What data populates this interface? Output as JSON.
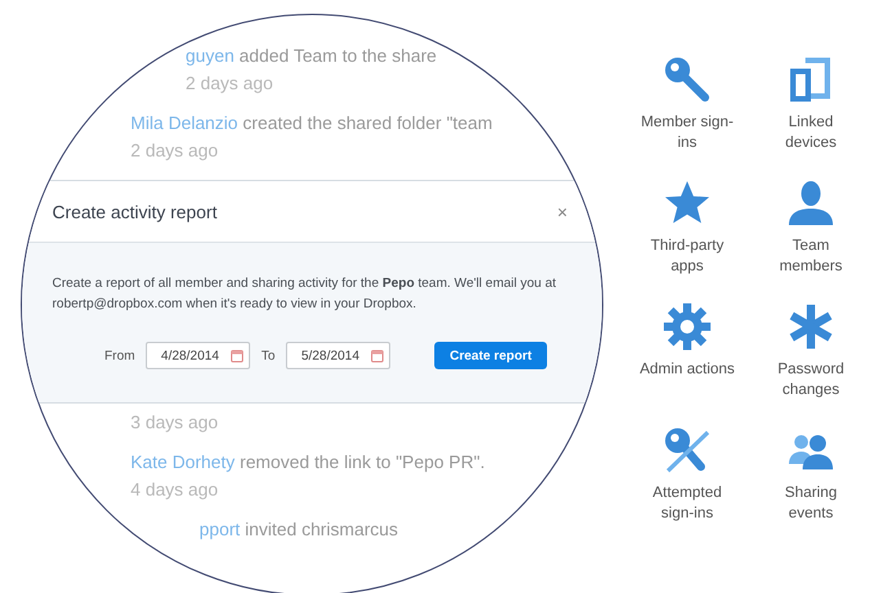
{
  "feed_top": [
    {
      "actor": "guyen",
      "action": "added Team to the share",
      "time": "2 days ago"
    },
    {
      "actor": "Mila Delanzio",
      "action": "created the shared folder \"team",
      "time": "2 days ago"
    }
  ],
  "modal": {
    "title": "Create activity report",
    "close": "×",
    "description": "Create a report of all member and sharing activity for the **Pepo** team. We'll email you at robertp@dropbox.com when it's ready to view in your Dropbox.",
    "from_label": "From",
    "from_value": "4/28/2014",
    "to_label": "To",
    "to_value": "5/28/2014",
    "button": "Create report"
  },
  "feed_bottom": [
    {
      "time": "3 days ago"
    },
    {
      "actor": "Kate Dorhety",
      "action": "removed the link to \"Pepo PR\".",
      "time": "4 days ago"
    },
    {
      "actor": "pport",
      "action": "invited chrismarcus"
    }
  ],
  "categories": [
    {
      "kind": "key",
      "label": "Member sign-ins"
    },
    {
      "kind": "devices",
      "label": "Linked devices"
    },
    {
      "kind": "star",
      "label": "Third-party apps"
    },
    {
      "kind": "person",
      "label": "Team members"
    },
    {
      "kind": "gear",
      "label": "Admin actions"
    },
    {
      "kind": "asterisk",
      "label": "Password changes"
    },
    {
      "kind": "key-slash",
      "label": "Attempted sign-ins"
    },
    {
      "kind": "people",
      "label": "Sharing events"
    }
  ]
}
